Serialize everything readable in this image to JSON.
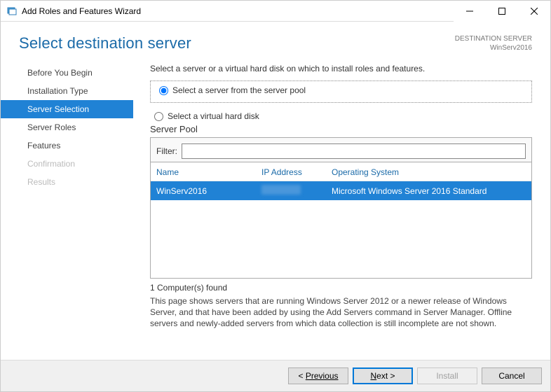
{
  "window": {
    "title": "Add Roles and Features Wizard"
  },
  "header": {
    "title": "Select destination server",
    "destination_label": "DESTINATION SERVER",
    "destination_value": "WinServ2016"
  },
  "sidebar": {
    "items": [
      {
        "label": "Before You Begin",
        "state": "normal"
      },
      {
        "label": "Installation Type",
        "state": "normal"
      },
      {
        "label": "Server Selection",
        "state": "active"
      },
      {
        "label": "Server Roles",
        "state": "normal"
      },
      {
        "label": "Features",
        "state": "normal"
      },
      {
        "label": "Confirmation",
        "state": "disabled"
      },
      {
        "label": "Results",
        "state": "disabled"
      }
    ]
  },
  "content": {
    "instruction": "Select a server or a virtual hard disk on which to install roles and features.",
    "radio": {
      "opt1": "Select a server from the server pool",
      "opt2": "Select a virtual hard disk",
      "selected": "opt1"
    },
    "pool_label": "Server Pool",
    "filter_label": "Filter:",
    "filter_value": "",
    "table": {
      "headers": {
        "name": "Name",
        "ip": "IP Address",
        "os": "Operating System"
      },
      "rows": [
        {
          "name": "WinServ2016",
          "ip": "",
          "os": "Microsoft Windows Server 2016 Standard"
        }
      ]
    },
    "found_text": "1 Computer(s) found",
    "explain": "This page shows servers that are running Windows Server 2012 or a newer release of Windows Server, and that have been added by using the Add Servers command in Server Manager. Offline servers and newly-added servers from which data collection is still incomplete are not shown."
  },
  "footer": {
    "previous": "Previous",
    "next": "Next >",
    "install": "Install",
    "cancel": "Cancel"
  }
}
